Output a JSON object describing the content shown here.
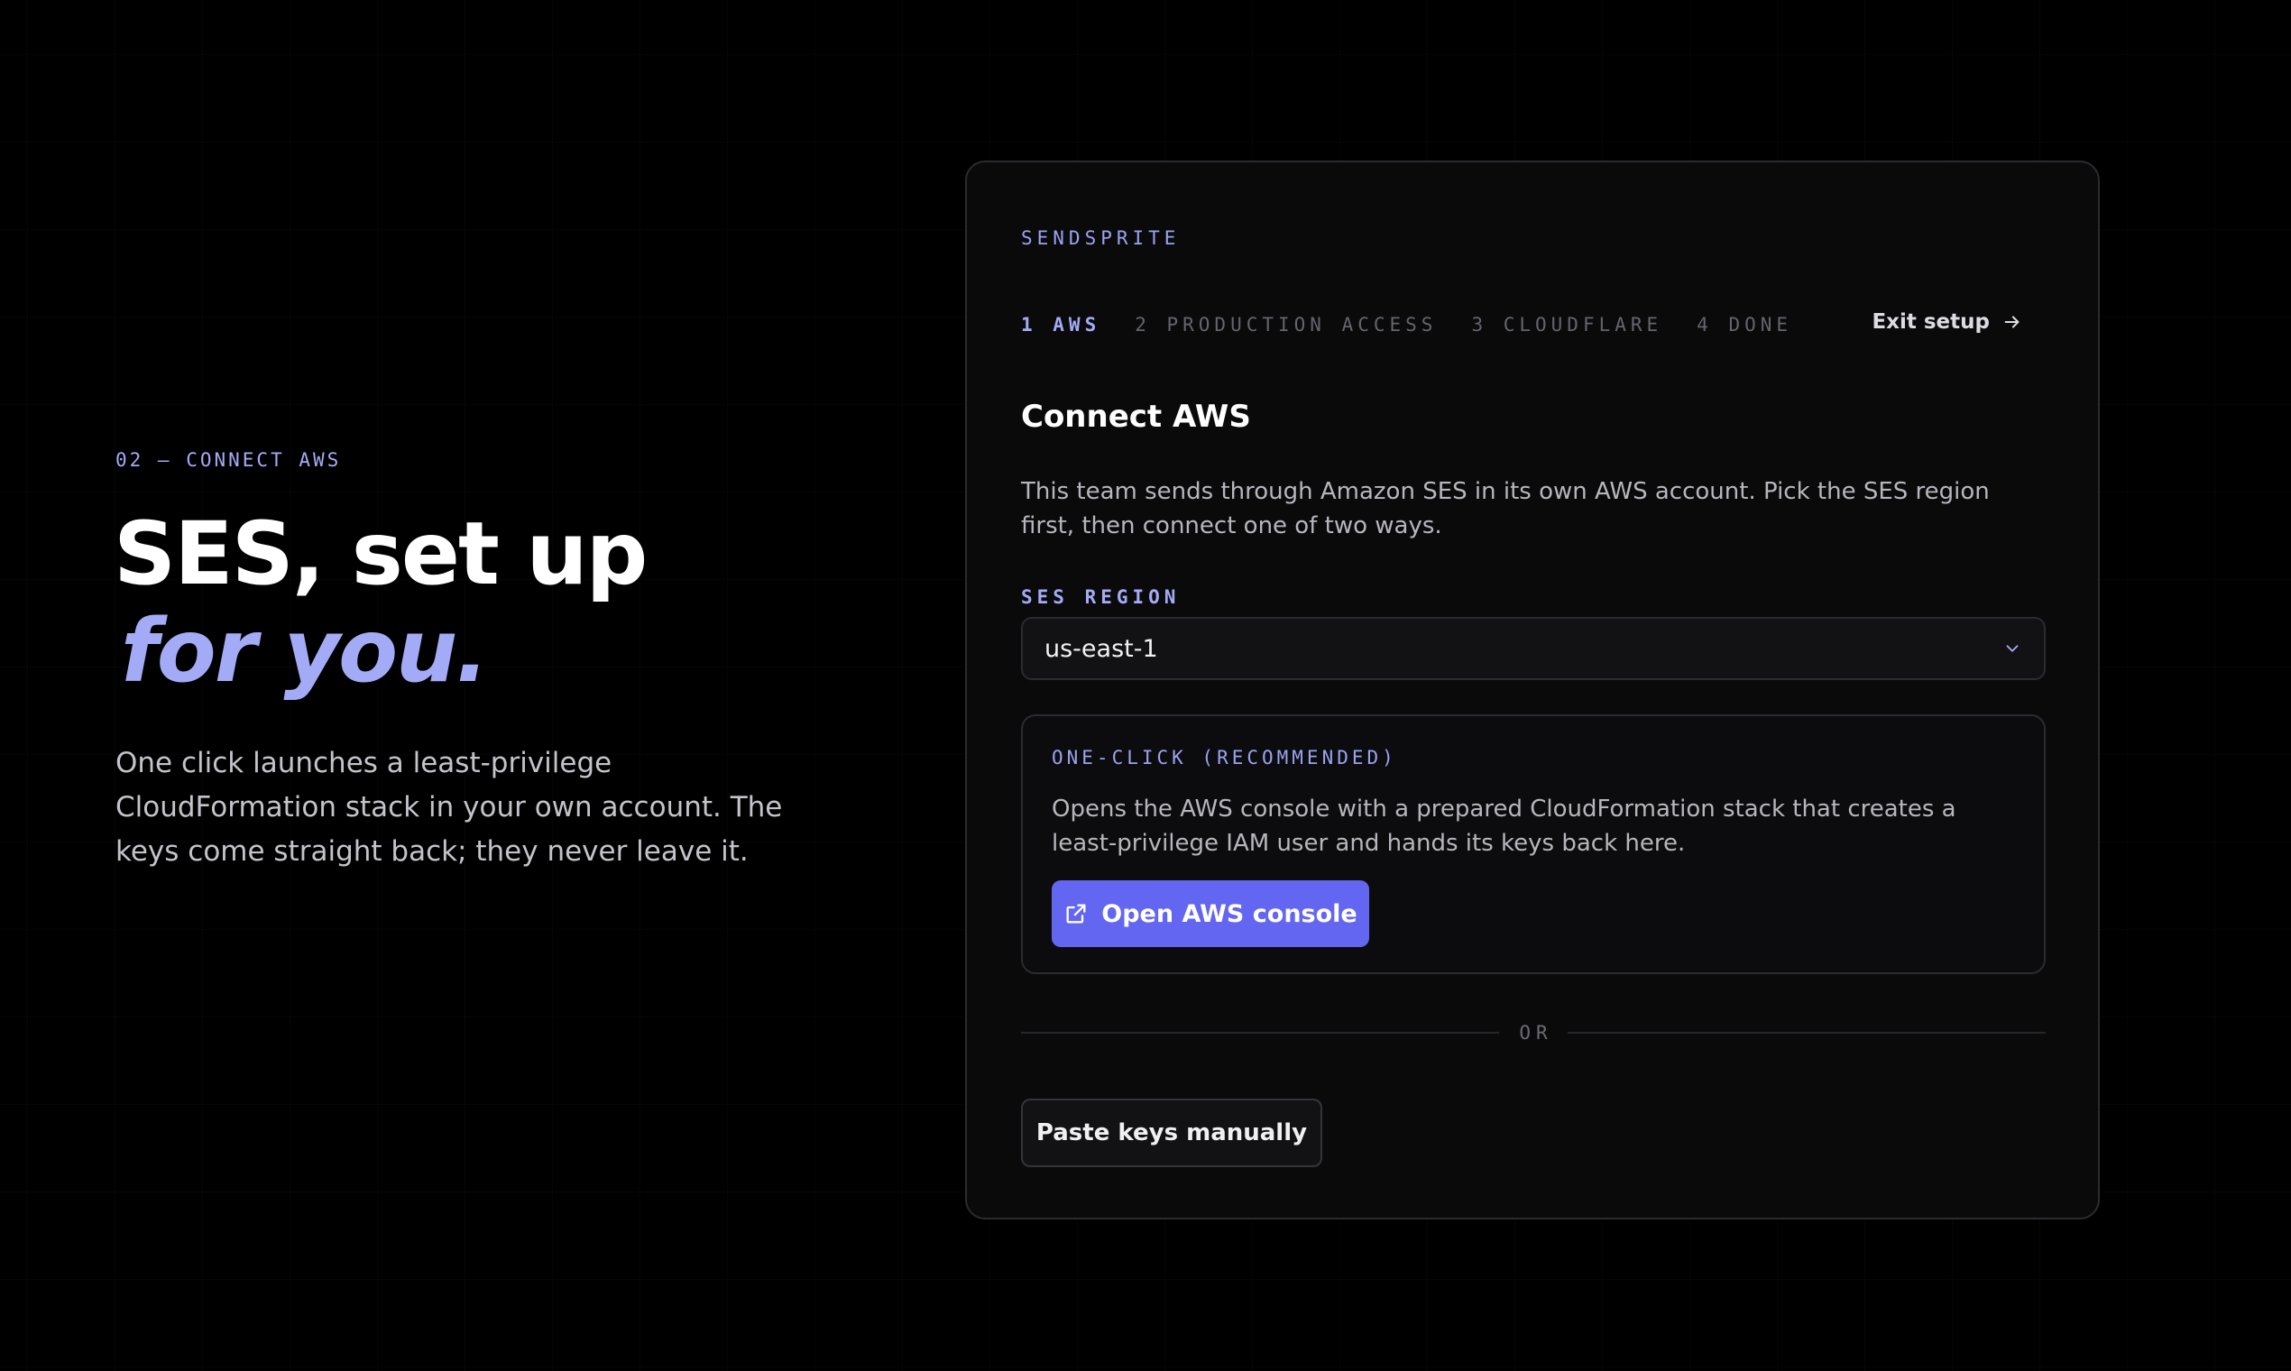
{
  "hero": {
    "eyebrow": "02 — CONNECT AWS",
    "title_line1": "SES, set up",
    "title_line2": "for you.",
    "copy": "One click launches a least-privilege CloudFormation stack in your own account. The keys come straight back; they never leave it."
  },
  "card": {
    "brand": "SENDSPRITE",
    "steps": [
      {
        "label": "1 AWS",
        "active": true
      },
      {
        "label": "2 PRODUCTION ACCESS",
        "active": false
      },
      {
        "label": "3 CLOUDFLARE",
        "active": false
      },
      {
        "label": "4 DONE",
        "active": false
      }
    ],
    "exit_label": "Exit setup",
    "title": "Connect AWS",
    "description": "This team sends through Amazon SES in its own AWS account. Pick the SES region first, then connect one of two ways.",
    "region": {
      "label": "SES REGION",
      "value": "us-east-1"
    },
    "one_click": {
      "label": "ONE-CLICK (RECOMMENDED)",
      "description": "Opens the AWS console with a prepared CloudFormation stack that creates a least-privilege IAM user and hands its keys back here.",
      "button_label": "Open AWS console",
      "button_icon": "external-link-icon"
    },
    "divider_text": "OR",
    "manual_button_label": "Paste keys manually"
  },
  "colors": {
    "background": "#000000",
    "card": "#0a0a0b",
    "accent": "#a4abf6",
    "primary_button": "#6366f1"
  }
}
